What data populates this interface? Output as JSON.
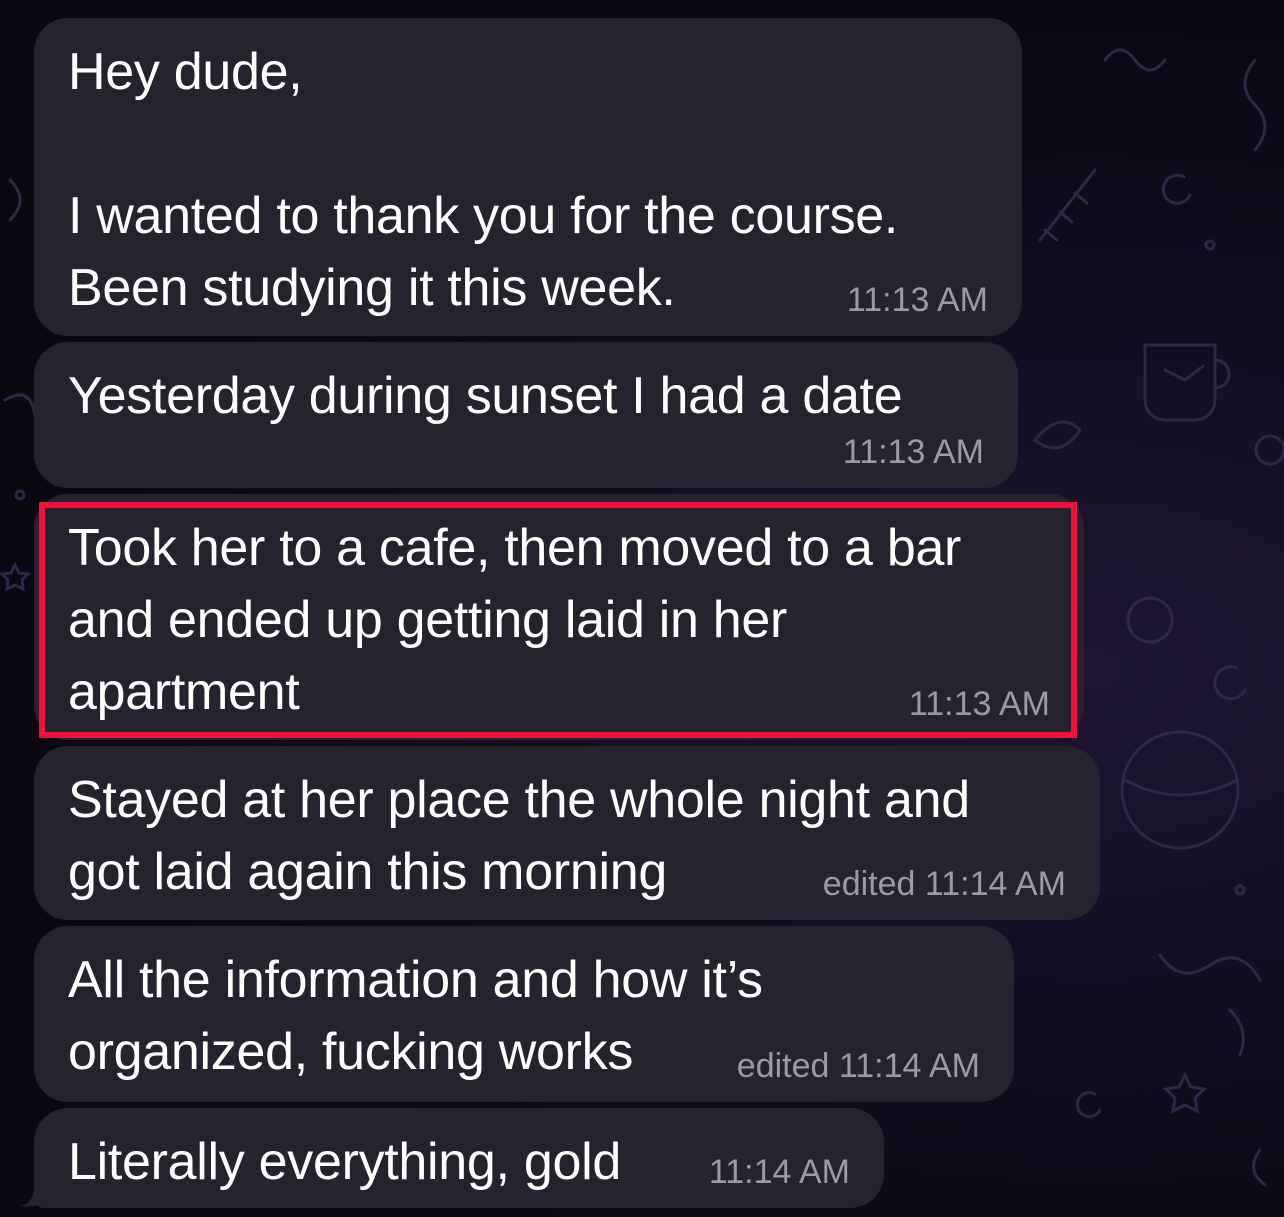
{
  "messages": [
    {
      "text": "Hey dude,\n\nI wanted to thank you for the course.\nBeen studying it this week.",
      "time": "11:13 AM"
    },
    {
      "text": "Yesterday during sunset I had a date",
      "time": "11:13 AM"
    },
    {
      "text": "Took her to a cafe, then moved to a bar\nand ended up getting laid in her\napartment",
      "time": "11:13 AM"
    },
    {
      "text": "Stayed at her place the whole night and\ngot laid again this morning",
      "time": "edited 11:14 AM"
    },
    {
      "text": "All the information and how it’s\norganized, fucking works",
      "time": "edited 11:14 AM"
    },
    {
      "text": "Literally everything, gold",
      "time": "11:14 AM"
    }
  ],
  "highlighted_message_index": 2,
  "colors": {
    "background": "#0a0912",
    "bubble": "#25232e",
    "text": "#ffffff",
    "timestamp": "#9d9aa8",
    "highlight_border": "#f20f3c"
  }
}
